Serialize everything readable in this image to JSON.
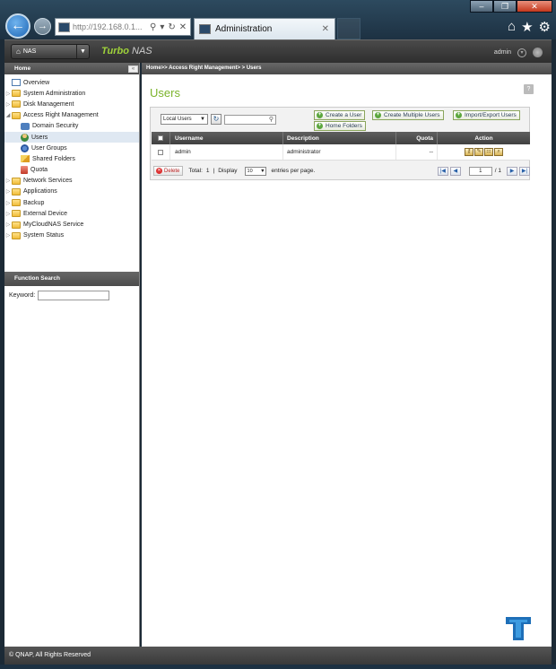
{
  "browser": {
    "address": "http://192.168.0.1...",
    "tab_title": "Administration",
    "window_controls": [
      "minimize-icon",
      "restore-icon",
      "close-icon"
    ],
    "tools": [
      "home-icon",
      "star-icon",
      "gear-icon"
    ]
  },
  "nas": {
    "selector_label": "NAS",
    "logo_turbo": "Turbo",
    "logo_nas": "NAS",
    "user": "admin"
  },
  "sidebar": {
    "header": "Home",
    "items": [
      {
        "label": "Overview",
        "level": 1
      },
      {
        "label": "System Administration",
        "level": 1
      },
      {
        "label": "Disk Management",
        "level": 1
      },
      {
        "label": "Access Right Management",
        "level": 1
      },
      {
        "label": "Domain Security",
        "level": 2
      },
      {
        "label": "Users",
        "level": 2
      },
      {
        "label": "User Groups",
        "level": 2
      },
      {
        "label": "Shared Folders",
        "level": 2
      },
      {
        "label": "Quota",
        "level": 2
      },
      {
        "label": "Network Services",
        "level": 1
      },
      {
        "label": "Applications",
        "level": 1
      },
      {
        "label": "Backup",
        "level": 1
      },
      {
        "label": "External Device",
        "level": 1
      },
      {
        "label": "MyCloudNAS Service",
        "level": 1
      },
      {
        "label": "System Status",
        "level": 1
      }
    ],
    "function_search": "Function Search",
    "keyword_label": "Keyword:"
  },
  "main": {
    "breadcrumb": "Home>> Access Right Management> > Users",
    "title": "Users",
    "filter_select": "Local Users",
    "buttons": {
      "create_user": "Create a User",
      "create_multiple": "Create Multiple Users",
      "import_export": "Import/Export Users",
      "home_folders": "Home Folders"
    },
    "table": {
      "headers": {
        "username": "Username",
        "description": "Description",
        "quota": "Quota",
        "action": "Action"
      },
      "rows": [
        {
          "username": "admin",
          "description": "administrator",
          "quota": "--"
        }
      ]
    },
    "pager": {
      "delete": "Delete",
      "total_label": "Total:",
      "total": "1",
      "sep": "|",
      "display_label": "Display",
      "display_value": "10",
      "per_page": "entries per page.",
      "page": "1",
      "of_pages": "/ 1"
    }
  },
  "footer": {
    "copyright": "© QNAP, All Rights Reserved"
  }
}
